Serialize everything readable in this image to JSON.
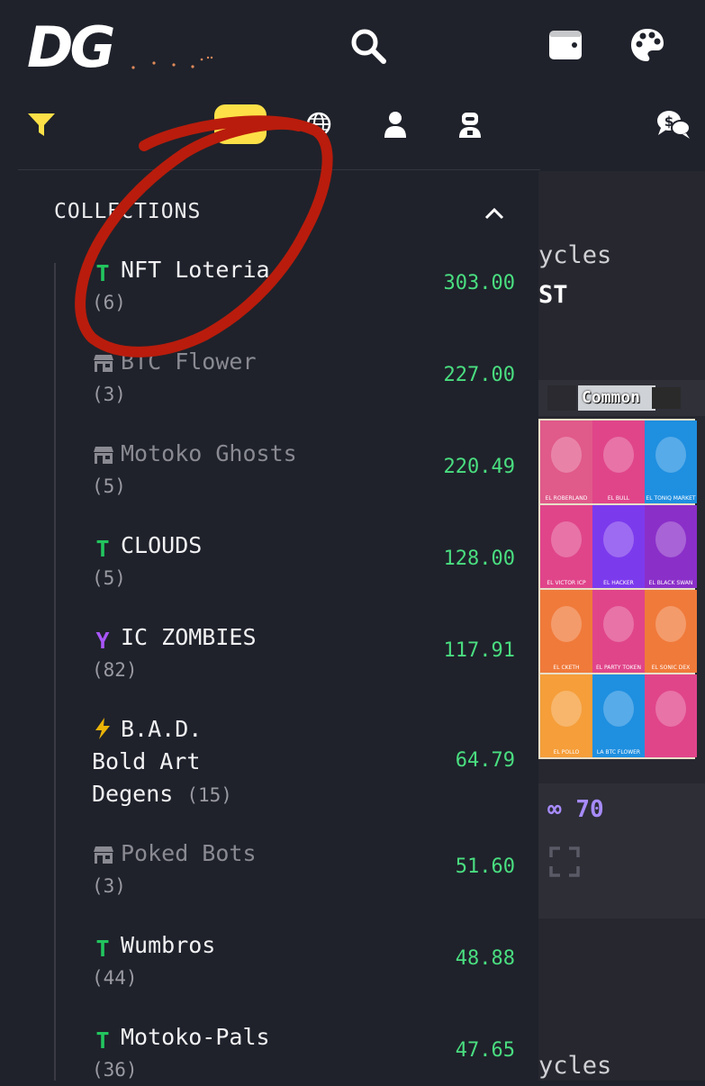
{
  "app": {
    "logo_text": "DG"
  },
  "sidebar": {
    "section_title": "COLLECTIONS",
    "items": [
      {
        "icon": "t-icon",
        "name": "NFT Loteria",
        "count": "(6)",
        "value": "303.00",
        "dim": false
      },
      {
        "icon": "store-icon",
        "name": "BTC Flower",
        "count": "(3)",
        "value": "227.00",
        "dim": true
      },
      {
        "icon": "store-icon",
        "name": "Motoko Ghosts",
        "count": "(5)",
        "value": "220.49",
        "dim": true
      },
      {
        "icon": "t-icon",
        "name": "CLOUDS",
        "count": "(5)",
        "value": "128.00",
        "dim": false
      },
      {
        "icon": "y-icon",
        "name": "IC ZOMBIES",
        "count": "(82)",
        "value": "117.91",
        "dim": false
      },
      {
        "icon": "bolt-icon",
        "name_lines": [
          "B.A.D.",
          "Bold Art",
          "Degens"
        ],
        "count": "(15)",
        "value": "64.79",
        "dim": false
      },
      {
        "icon": "store-icon",
        "name": "Poked Bots",
        "count": "(3)",
        "value": "51.60",
        "dim": true
      },
      {
        "icon": "t-icon",
        "name": "Wumbros",
        "count": "(44)",
        "value": "48.88",
        "dim": false
      },
      {
        "icon": "t-icon",
        "name": "Motoko-Pals",
        "count": "(36)",
        "value": "47.65",
        "dim": false
      }
    ]
  },
  "background": {
    "title_fragment": "ycles",
    "subtitle_fragment": "ST",
    "rarity_badge": "Common",
    "stat_value": "70",
    "footer_fragment": "ycles",
    "cards": [
      {
        "caption": "EL ROBERLAND",
        "bg": "#e05a8a"
      },
      {
        "caption": "EL BULL",
        "bg": "#e0458a"
      },
      {
        "caption": "EL TONIQ MARKET",
        "bg": "#1f8fe0"
      },
      {
        "caption": "EL VICTOR ICP",
        "bg": "#e0458a"
      },
      {
        "caption": "EL HACKER",
        "bg": "#7c3aed"
      },
      {
        "caption": "EL BLACK SWAN",
        "bg": "#8b2fc9"
      },
      {
        "caption": "EL CKETH",
        "bg": "#f07a3a"
      },
      {
        "caption": "EL PARTY TOKEN",
        "bg": "#e0458a"
      },
      {
        "caption": "EL SONIC DEX",
        "bg": "#f07a3a"
      },
      {
        "caption": "EL POLLO",
        "bg": "#f59e3a"
      },
      {
        "caption": "LA BTC FLOWER",
        "bg": "#1f8fe0"
      },
      {
        "caption": "",
        "bg": "#e0458a"
      }
    ]
  },
  "colors": {
    "accent_green": "#4ade80",
    "filter_yellow": "#fde047",
    "annotation_red": "#b91c0c"
  }
}
